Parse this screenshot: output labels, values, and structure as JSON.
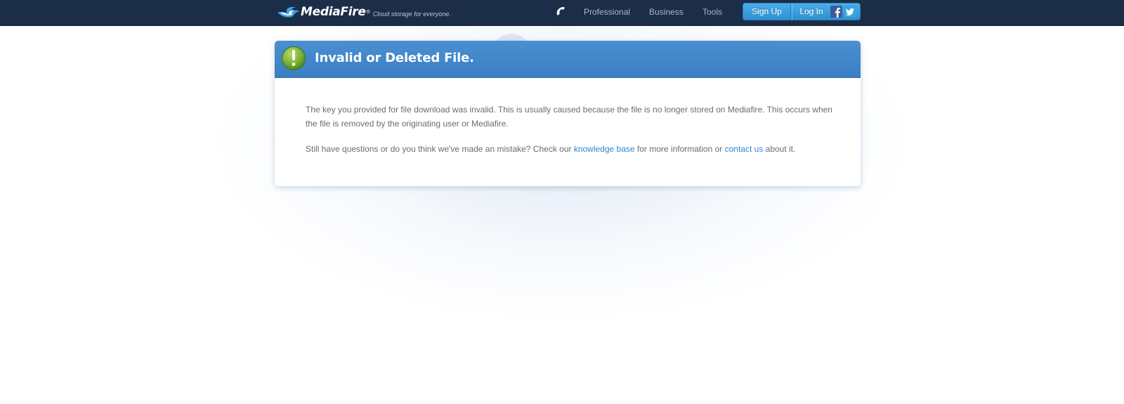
{
  "header": {
    "logo_text": "MediaFire",
    "logo_reg": "®",
    "tagline": "Cloud storage for everyone.",
    "nav": {
      "professional": "Professional",
      "business": "Business",
      "tools": "Tools"
    },
    "signup_label": "Sign Up",
    "login_label": "Log In",
    "icons": [
      "phone-icon",
      "facebook-icon",
      "twitter-icon"
    ]
  },
  "error_card": {
    "title": "Invalid or Deleted File.",
    "icon": "exclamation-icon",
    "message": "The key you provided for file download was invalid. This is usually caused because the file is no longer stored on Mediafire. This occurs when the file is removed by the originating user or Mediafire.",
    "help_before": "Still have questions or do you think we've made an mistake? Check our ",
    "knowledge_base_link": "knowledge base",
    "help_middle": " for more information or ",
    "contact_link": "contact us",
    "help_after": " about it."
  },
  "colors": {
    "topbar": "#1c2e47",
    "card_header": "#3f86c9",
    "auth_button": "#3b9fe0",
    "link": "#2f86cf",
    "alert_icon": "#7fb33a"
  }
}
